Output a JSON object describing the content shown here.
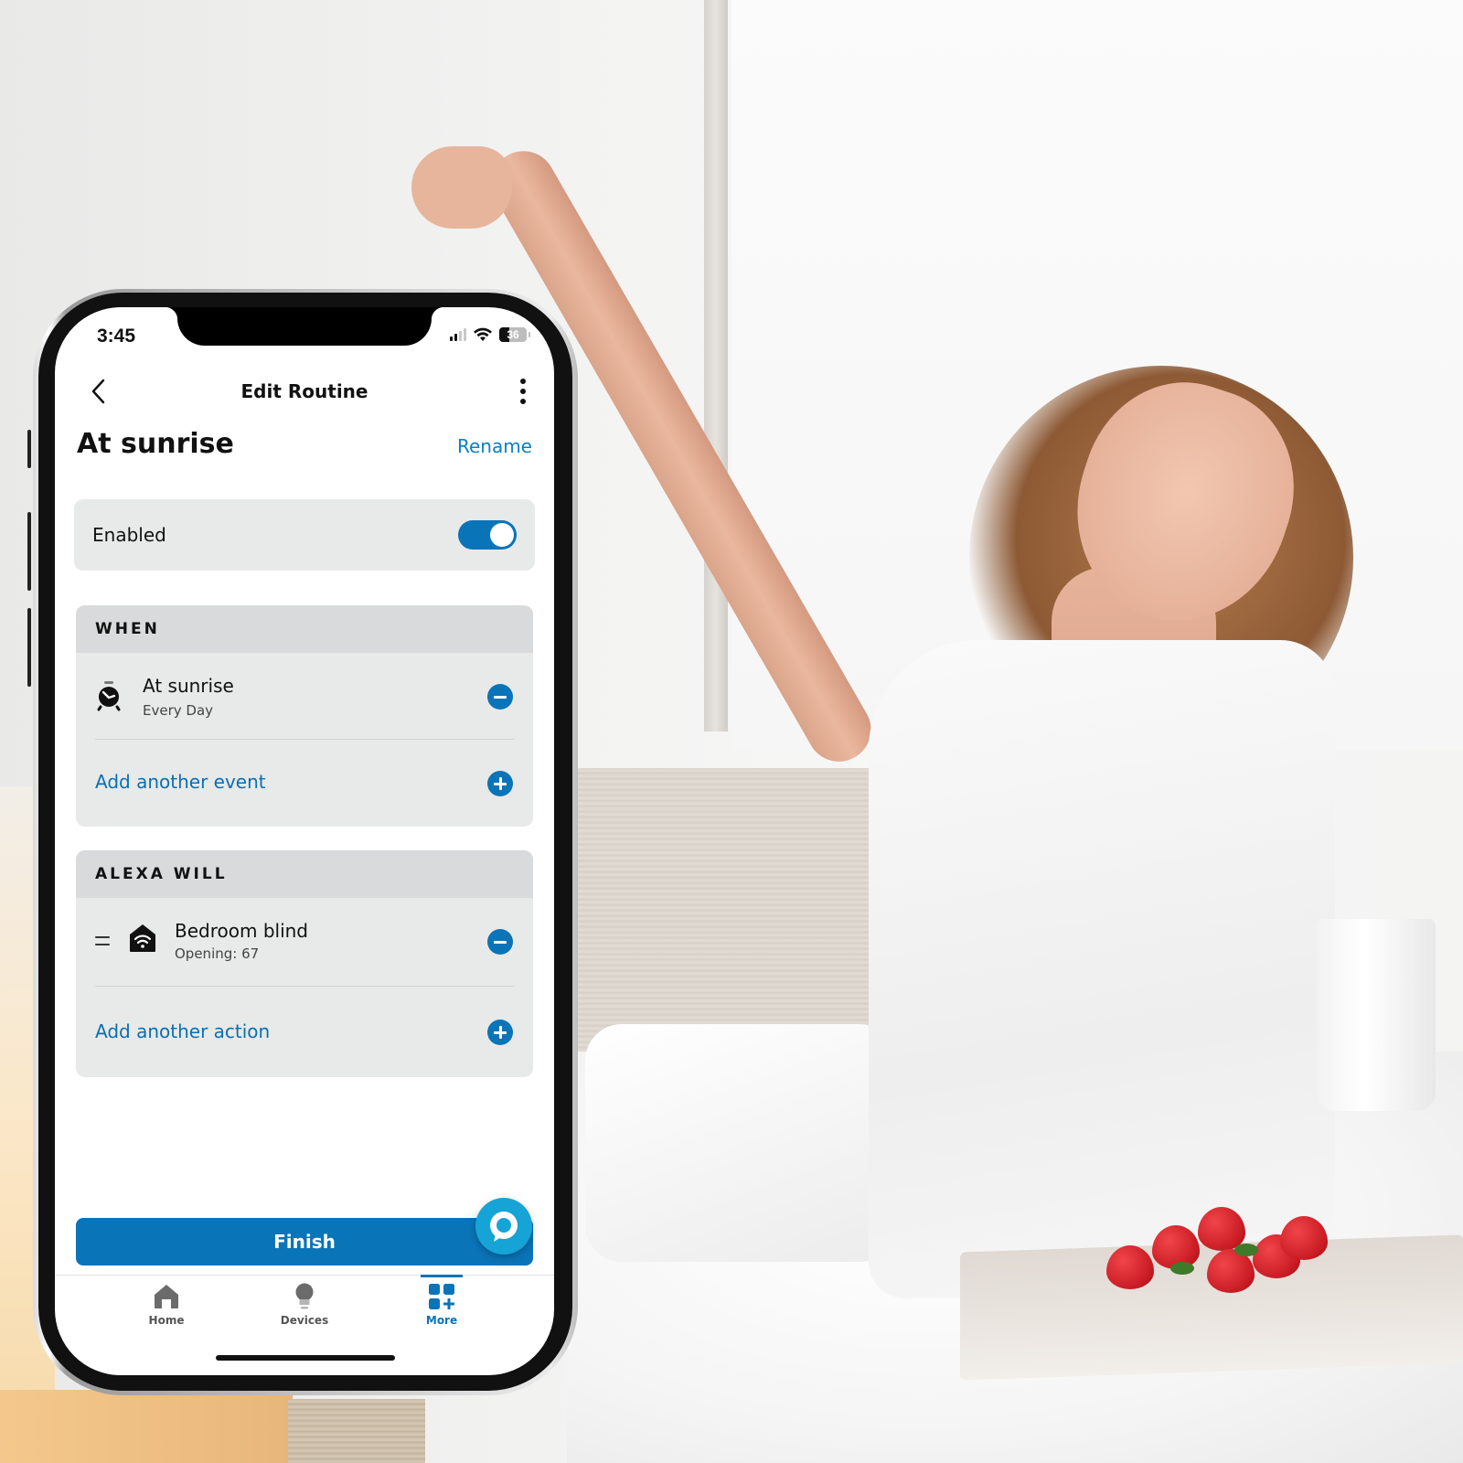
{
  "status_bar": {
    "time": "3:45",
    "battery_level": "36",
    "battery_fraction": 0.36,
    "signal_bars_active": 2,
    "signal_bars_total": 4
  },
  "nav": {
    "title": "Edit Routine",
    "back_icon": "chevron-left-icon",
    "more_icon": "more-vertical-icon"
  },
  "routine": {
    "name": "At sunrise",
    "rename_label": "Rename"
  },
  "enabled": {
    "label": "Enabled",
    "value": true
  },
  "when": {
    "header": "WHEN",
    "items": [
      {
        "icon": "alarm-clock-icon",
        "title": "At sunrise",
        "subtitle": "Every Day"
      }
    ],
    "add_label": "Add another event"
  },
  "alexa_will": {
    "header": "ALEXA WILL",
    "items": [
      {
        "icon": "smart-home-icon",
        "title": "Bedroom blind",
        "subtitle": "Opening: 67"
      }
    ],
    "add_label": "Add another action"
  },
  "finish_label": "Finish",
  "tabs": [
    {
      "label": "Home",
      "icon": "home-icon",
      "active": false
    },
    {
      "label": "Devices",
      "icon": "lightbulb-icon",
      "active": false
    },
    {
      "label": "More",
      "icon": "grid-plus-icon",
      "active": true
    }
  ],
  "colors": {
    "accent": "#0a74b8",
    "link": "#0a7fc2",
    "alexa_fab": "#16a3d6",
    "card_bg": "#e8e9e9",
    "section_header_bg": "#d9dadb"
  }
}
